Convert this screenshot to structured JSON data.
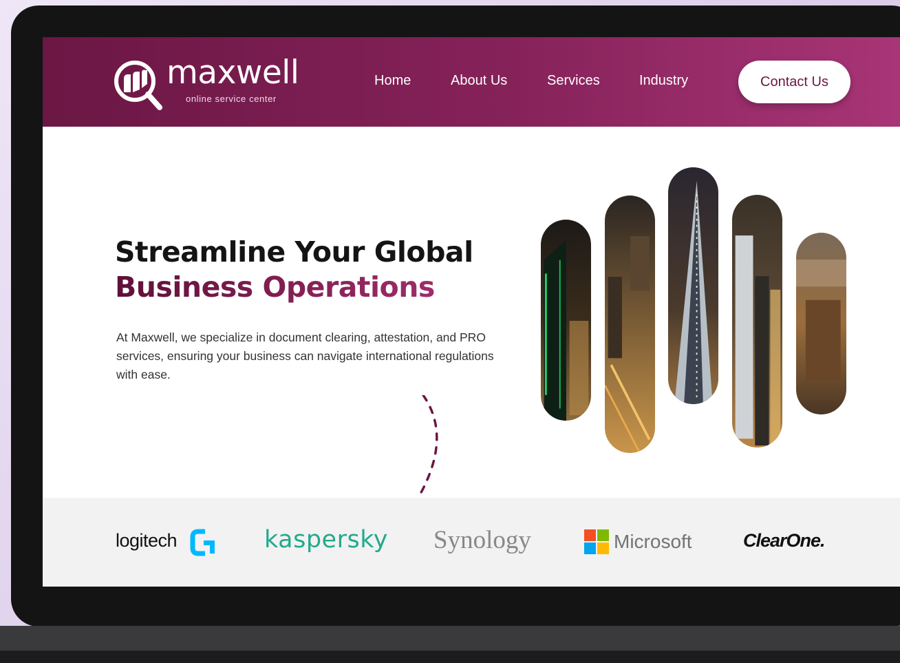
{
  "brand": {
    "name": "maxwell",
    "tagline": "online service center"
  },
  "nav": {
    "links": [
      "Home",
      "About Us",
      "Services",
      "Industry"
    ],
    "contact_button": "Contact Us"
  },
  "hero": {
    "title_line1": "Streamline Your Global",
    "title_line2": "Business Operations",
    "description": "At Maxwell, we specialize in document clearing, attestation, and PRO services, ensuring your business can navigate international regulations with ease."
  },
  "partners": {
    "logitech": "logitech",
    "kaspersky": "kaspersky",
    "synology": "Synology",
    "microsoft": "Microsoft",
    "clearone": "ClearOne."
  },
  "colors": {
    "brand_primary": "#6b1744",
    "brand_secondary": "#a83577",
    "kaspersky_green": "#23a98d",
    "logitech_blue": "#00b8fc"
  }
}
